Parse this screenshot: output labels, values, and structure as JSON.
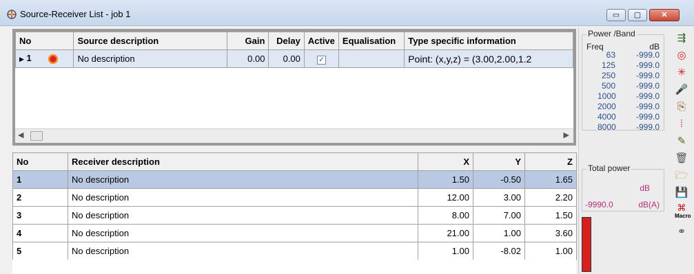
{
  "window": {
    "title": "Source-Receiver List - job 1",
    "min_glyph": "▭",
    "max_glyph": "▢",
    "close_glyph": "✕"
  },
  "source_table": {
    "headers": [
      "No",
      "Source description",
      "Gain",
      "Delay",
      "Active",
      "Equalisation",
      "Type specific information"
    ],
    "rows": [
      {
        "no": "1",
        "description": "No description",
        "gain": "0.00",
        "delay": "0.00",
        "active": true,
        "equalisation": "",
        "type_info": "Point:  (x,y,z) = (3.00,2.00,1.2"
      }
    ]
  },
  "receiver_table": {
    "headers": [
      "No",
      "Receiver description",
      "X",
      "Y",
      "Z"
    ],
    "rows": [
      {
        "no": "1",
        "description": "No description",
        "x": "1.50",
        "y": "-0.50",
        "z": "1.65"
      },
      {
        "no": "2",
        "description": "No description",
        "x": "12.00",
        "y": "3.00",
        "z": "2.20"
      },
      {
        "no": "3",
        "description": "No description",
        "x": "8.00",
        "y": "7.00",
        "z": "1.50"
      },
      {
        "no": "4",
        "description": "No description",
        "x": "21.00",
        "y": "1.00",
        "z": "3.60"
      },
      {
        "no": "5",
        "description": "No description",
        "x": "1.00",
        "y": "-8.02",
        "z": "1.00"
      }
    ]
  },
  "power_band": {
    "title": "Power /Band",
    "freq_label": "Freq",
    "unit_label": "dB",
    "rows": [
      {
        "freq": "63",
        "value": "-999.0"
      },
      {
        "freq": "125",
        "value": "-999.0"
      },
      {
        "freq": "250",
        "value": "-999.0"
      },
      {
        "freq": "500",
        "value": "-999.0"
      },
      {
        "freq": "1000",
        "value": "-999.0"
      },
      {
        "freq": "2000",
        "value": "-999.0"
      },
      {
        "freq": "4000",
        "value": "-999.0"
      },
      {
        "freq": "8000",
        "value": "-999.0"
      }
    ]
  },
  "total_power": {
    "title": "Total power",
    "db_label": "dB",
    "dba_value": "-9990.0",
    "dba_label": "dB(A)"
  },
  "toolbar": {
    "tools": [
      {
        "name": "align-tool-icon",
        "glyph": "⇶",
        "color": "#2d6a2d"
      },
      {
        "name": "target-icon",
        "glyph": "◎",
        "color": "#d41f1f"
      },
      {
        "name": "burst-icon",
        "glyph": "✳",
        "color": "#d42020"
      },
      {
        "name": "microphone-icon",
        "glyph": "🎤",
        "color": "#9b2a2a"
      },
      {
        "name": "copy-icon",
        "glyph": "⎘",
        "color": "#8a5a10"
      },
      {
        "name": "dots-pattern-icon",
        "glyph": "⁞",
        "color": "#c4348a"
      },
      {
        "name": "document-edit-icon",
        "glyph": "✎",
        "color": "#6a5a1a"
      },
      {
        "name": "trash-icon",
        "glyph": "🗑",
        "color": "#555555"
      },
      {
        "name": "open-folder-icon",
        "glyph": "🗁",
        "color": "#b28a1a"
      },
      {
        "name": "save-icon",
        "glyph": "💾",
        "color": "#222222"
      },
      {
        "name": "macro-icon",
        "glyph": "⌘",
        "color": "#c01010",
        "label": "Macro"
      },
      {
        "name": "link-icon",
        "glyph": "⚭",
        "color": "#555555"
      }
    ]
  },
  "colors": {
    "selection": "#b9c9e4",
    "meter": "#d61f1f",
    "band_text": "#2a4f8f",
    "total_text": "#b0307a"
  }
}
